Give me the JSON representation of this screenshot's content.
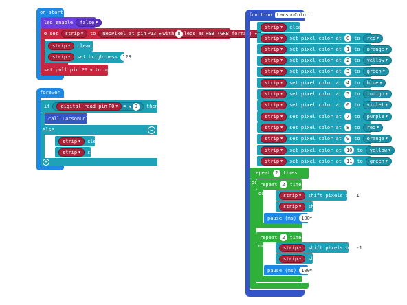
{
  "on_start": {
    "header": "on start",
    "led_enable": "led enable",
    "led_value": "false",
    "set_label": "set",
    "strip": "strip",
    "to": "to",
    "neopixel_label": "NeoPixel at pin",
    "pin": "P13",
    "with": "with",
    "leds_count": "8",
    "leds_as": "leds as",
    "format": "RGB (GRB format)",
    "clear": "clear",
    "set_brightness": "set brightness",
    "brightness_value": "128",
    "set_pull_pin": "set pull pin",
    "pull_pin": "P0",
    "pull_mode": "up"
  },
  "forever": {
    "header": "forever",
    "if": "if",
    "digital_read": "digital read pin",
    "read_pin": "P0",
    "op": "=",
    "compare_value": "0",
    "then": "then",
    "call": "call",
    "call_fn": "LarsonColor",
    "else": "else",
    "strip": "strip",
    "clear": "clear",
    "show": "show"
  },
  "function": {
    "header": "function",
    "name": "LarsonColor",
    "strip": "strip",
    "clear": "clear",
    "set_pixel": "set pixel color at",
    "to": "to",
    "pixels": [
      {
        "index": "0",
        "color": "red"
      },
      {
        "index": "1",
        "color": "orange"
      },
      {
        "index": "2",
        "color": "yellow"
      },
      {
        "index": "3",
        "color": "green"
      },
      {
        "index": "4",
        "color": "blue"
      },
      {
        "index": "5",
        "color": "indigo"
      },
      {
        "index": "6",
        "color": "violet"
      },
      {
        "index": "7",
        "color": "purple"
      },
      {
        "index": "8",
        "color": "red"
      },
      {
        "index": "9",
        "color": "orange"
      },
      {
        "index": "10",
        "color": "yellow"
      },
      {
        "index": "11",
        "color": "green"
      }
    ],
    "repeat": "repeat",
    "times": "times",
    "do": "do",
    "outer_repeat": "2",
    "inner_repeat_1": "2",
    "inner_repeat_2": "2",
    "shift_pixels": "shift pixels by",
    "shift_1": "1",
    "shift_2": "-1",
    "show": "show",
    "pause": "pause (ms)",
    "pause_1": "100",
    "pause_2": "100"
  }
}
